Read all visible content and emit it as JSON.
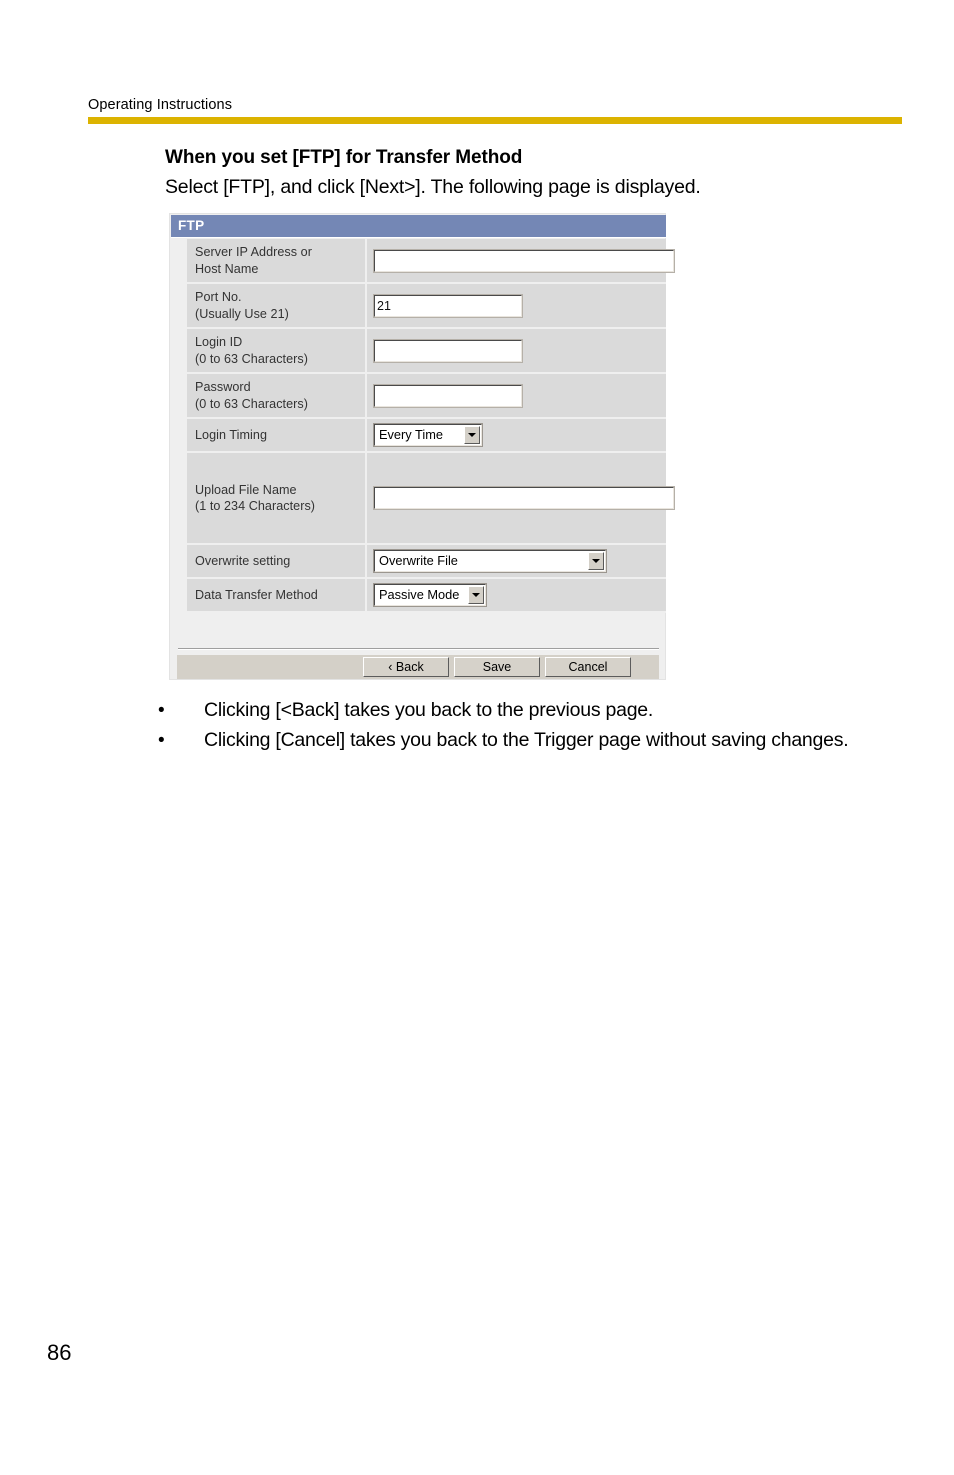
{
  "page": {
    "running_head": "Operating Instructions",
    "folio": "86",
    "rule_color": "#dcb300"
  },
  "section": {
    "title": "When you set [FTP] for Transfer Method",
    "intro": "Select [FTP], and click [Next>]. The following page is displayed."
  },
  "screenshot": {
    "titlebar": {
      "label": "FTP",
      "bg_color": "#7487b5",
      "text_color": "#ffffff"
    },
    "rows": [
      {
        "label_line1": "Server IP Address or",
        "label_line2": "Host Name",
        "control": "text",
        "value": ""
      },
      {
        "label_line1": "Port No.",
        "label_line2": "(Usually Use 21)",
        "control": "text",
        "value": "21"
      },
      {
        "label_line1": "Login ID",
        "label_line2": "(0 to 63 Characters)",
        "control": "text",
        "value": ""
      },
      {
        "label_line1": "Password",
        "label_line2": "(0 to 63 Characters)",
        "control": "text",
        "value": ""
      },
      {
        "label_line1": "Login Timing",
        "label_line2": "",
        "control": "select",
        "value": "Every Time"
      },
      {
        "label_line1": "Upload File Name",
        "label_line2": "(1 to 234 Characters)",
        "control": "text",
        "value": ""
      },
      {
        "label_line1": "Overwrite setting",
        "label_line2": "",
        "control": "select",
        "value": "Overwrite File"
      },
      {
        "label_line1": "Data Transfer Method",
        "label_line2": "",
        "control": "select",
        "value": "Passive Mode"
      }
    ],
    "buttons": {
      "back": "‹ Back",
      "save": "Save",
      "cancel": "Cancel"
    }
  },
  "notes": {
    "bullet_glyph": "•",
    "items": [
      "Clicking [<Back] takes you back to the previous page.",
      "Clicking [Cancel] takes you back to the Trigger page without saving changes."
    ]
  }
}
